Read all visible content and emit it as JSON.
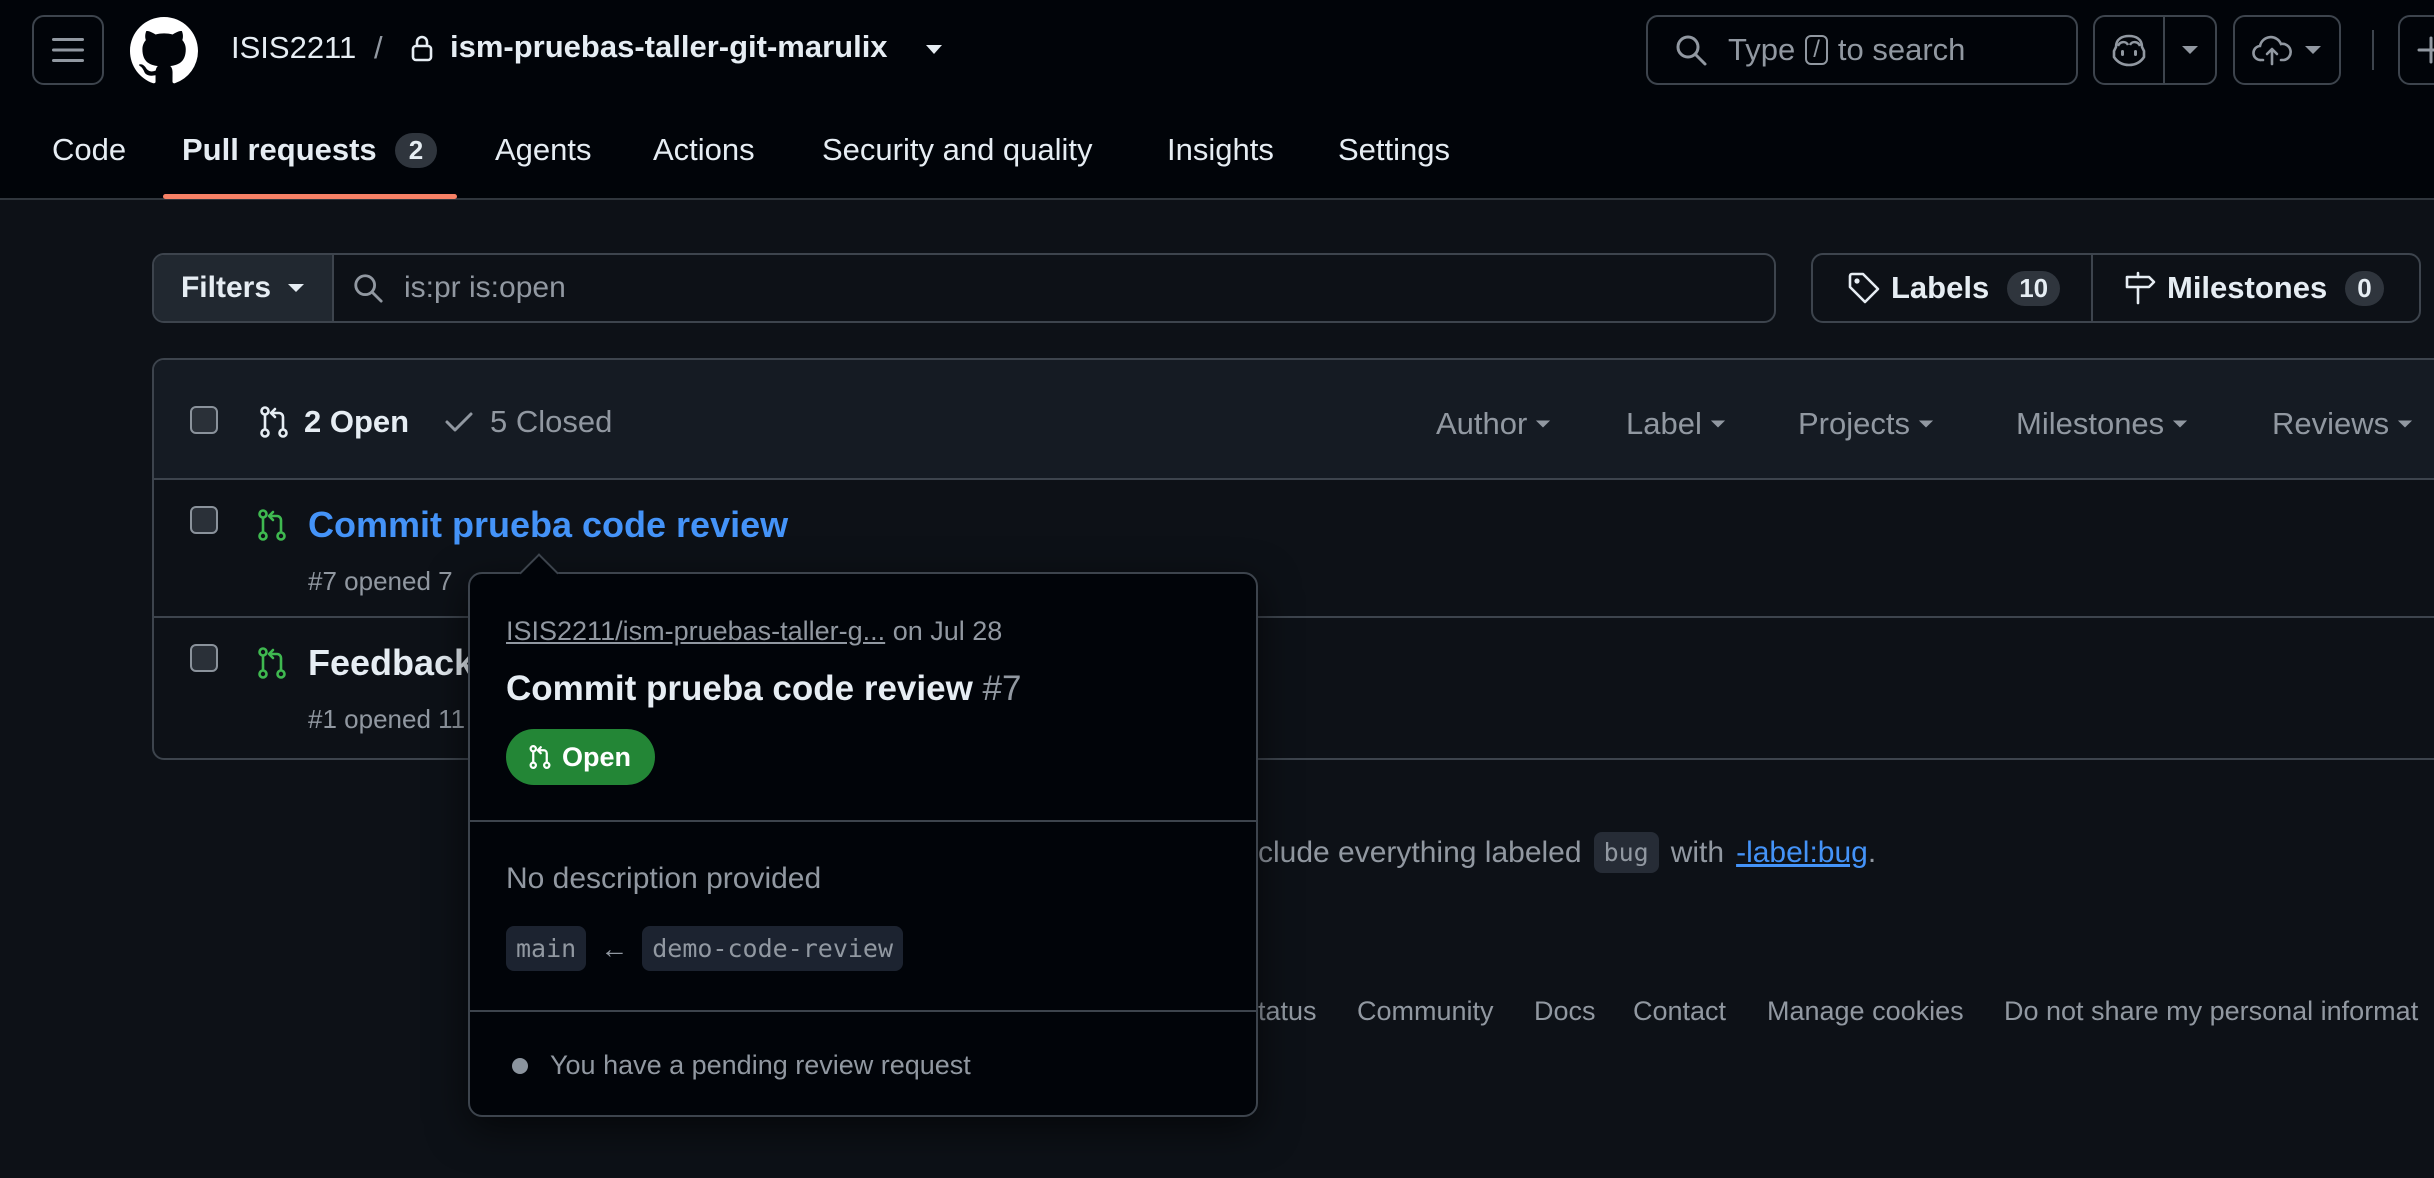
{
  "header": {
    "owner": "ISIS2211",
    "separator": "/",
    "repo": "ism-pruebas-taller-git-marulix",
    "search": {
      "prefix": "Type",
      "key": "/",
      "suffix": "to search"
    }
  },
  "tabs": [
    {
      "label": "Code"
    },
    {
      "label": "Pull requests",
      "count": "2"
    },
    {
      "label": "Agents"
    },
    {
      "label": "Actions"
    },
    {
      "label": "Security and quality"
    },
    {
      "label": "Insights"
    },
    {
      "label": "Settings"
    }
  ],
  "filter_bar": {
    "filters_label": "Filters",
    "query": "is:pr is:open",
    "labels_label": "Labels",
    "labels_count": "10",
    "milestones_label": "Milestones",
    "milestones_count": "0"
  },
  "list": {
    "open_label": "2 Open",
    "closed_label": "5 Closed",
    "filters": [
      "Author",
      "Label",
      "Projects",
      "Milestones",
      "Reviews"
    ],
    "rows": [
      {
        "title": "Commit prueba code review",
        "meta": "#7 opened 7"
      },
      {
        "title": "Feedback",
        "meta": "#1 opened 11"
      }
    ]
  },
  "protip": {
    "text_before": "clude everything labeled",
    "code": "bug",
    "text_mid": "with",
    "link": "-label:bug",
    "text_after": "."
  },
  "footer": {
    "links": [
      "tatus",
      "Community",
      "Docs",
      "Contact",
      "Manage cookies",
      "Do not share my personal informat"
    ]
  },
  "hovercard": {
    "repo_link": "ISIS2211/ism-pruebas-taller-g...",
    "date": "on Jul 28",
    "title": "Commit prueba code review",
    "number": "#7",
    "badge": "Open",
    "description": "No description provided",
    "base_branch": "main",
    "arrow": "←",
    "head_branch": "demo-code-review",
    "review_note": "You have a pending review request"
  },
  "colors": {
    "background": "#0d1117",
    "header_bg": "#010409",
    "accent_underline": "#f78166",
    "link": "#4493f8",
    "open_green": "#238636",
    "icon_green": "#3fb950"
  }
}
